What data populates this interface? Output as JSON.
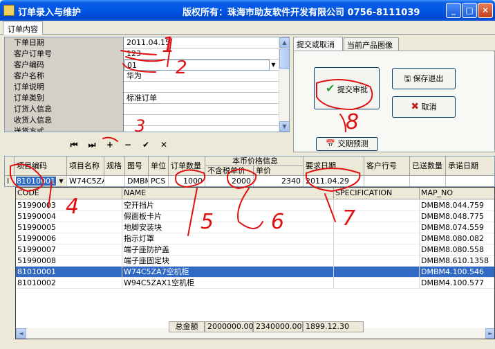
{
  "window": {
    "title": "订单录入与维护",
    "copyright": "版权所有：珠海市助友软件开发有限公司 0756-8111039",
    "min_glyph": "_",
    "max_glyph": "□",
    "close_glyph": "✕"
  },
  "main_tab": "订单内容",
  "properties": [
    {
      "label": "下单日期",
      "value": "2011.04.15"
    },
    {
      "label": "客户订单号",
      "value": "123"
    },
    {
      "label": "客户编码",
      "value": "01"
    },
    {
      "label": "客户名称",
      "value": "华为"
    },
    {
      "label": "订单说明",
      "value": ""
    },
    {
      "label": "订单类别",
      "value": "标准订单"
    },
    {
      "label": "订货人信息",
      "value": ""
    },
    {
      "label": "收货人信息",
      "value": ""
    },
    {
      "label": "送货方式",
      "value": ""
    }
  ],
  "nav": {
    "first": "⏮",
    "last": "⏭",
    "add": "+",
    "remove": "−",
    "post": "✔",
    "cancel": "✕"
  },
  "right_tabs": [
    "提交或取消",
    "当前产品图像"
  ],
  "buttons": {
    "submit": "提交审批",
    "save_exit": "保存退出",
    "cancel": "取消",
    "forecast": "交期预测"
  },
  "order_grid": {
    "headers": [
      "项目编码",
      "项目名称",
      "规格",
      "图号",
      "单位",
      "订单数量",
      "本币价格信息",
      "不含税单价",
      "单价",
      "要求日期",
      "客户行号",
      "已送数量",
      "承诺日期"
    ],
    "row": {
      "indicator": "I",
      "code": "81010001",
      "name": "W74C5ZA",
      "spec": "",
      "drawing": "DMBM",
      "unit": "PCS",
      "qty": "1000",
      "net_price": "2000",
      "price": "2340",
      "req_date": "2011.04.29",
      "cust_line": "",
      "sent": "",
      "promise": ""
    }
  },
  "dropdown": {
    "headers": [
      "CODE",
      "NAME",
      "SPECIFICATION",
      "MAP_NO"
    ],
    "rows": [
      {
        "code": "51990003",
        "name": "空开挡片",
        "spec": "",
        "map": "DMBM8.044.759",
        "selected": false
      },
      {
        "code": "51990004",
        "name": "假面板卡片",
        "spec": "",
        "map": "DMBM8.048.775",
        "selected": false
      },
      {
        "code": "51990005",
        "name": "地脚安装块",
        "spec": "",
        "map": "DMBM8.074.559",
        "selected": false
      },
      {
        "code": "51990006",
        "name": "指示灯罩",
        "spec": "",
        "map": "DMBM8.080.082",
        "selected": false
      },
      {
        "code": "51990007",
        "name": "端子座防护盖",
        "spec": "",
        "map": "DMBM8.080.558",
        "selected": false
      },
      {
        "code": "51990008",
        "name": "端子座固定块",
        "spec": "",
        "map": "DMBM8.610.1358",
        "selected": false
      },
      {
        "code": "81010001",
        "name": "W74C5ZA7空机柜",
        "spec": "",
        "map": "DMBM4.100.546",
        "selected": true
      },
      {
        "code": "81010002",
        "name": "W94C5ZAX1空机柜",
        "spec": "",
        "map": "DMBM4.100.577",
        "selected": false
      }
    ]
  },
  "totals": {
    "label": "总金额",
    "net": "2000000.00",
    "gross": "2340000.00",
    "date": "1899.12.30"
  },
  "annotations": [
    "1",
    "2",
    "3",
    "4",
    "5",
    "6",
    "7",
    "8"
  ],
  "colors": {
    "titlebar": "#0055e5",
    "selection": "#316ac5",
    "annotation": "#e01010"
  }
}
